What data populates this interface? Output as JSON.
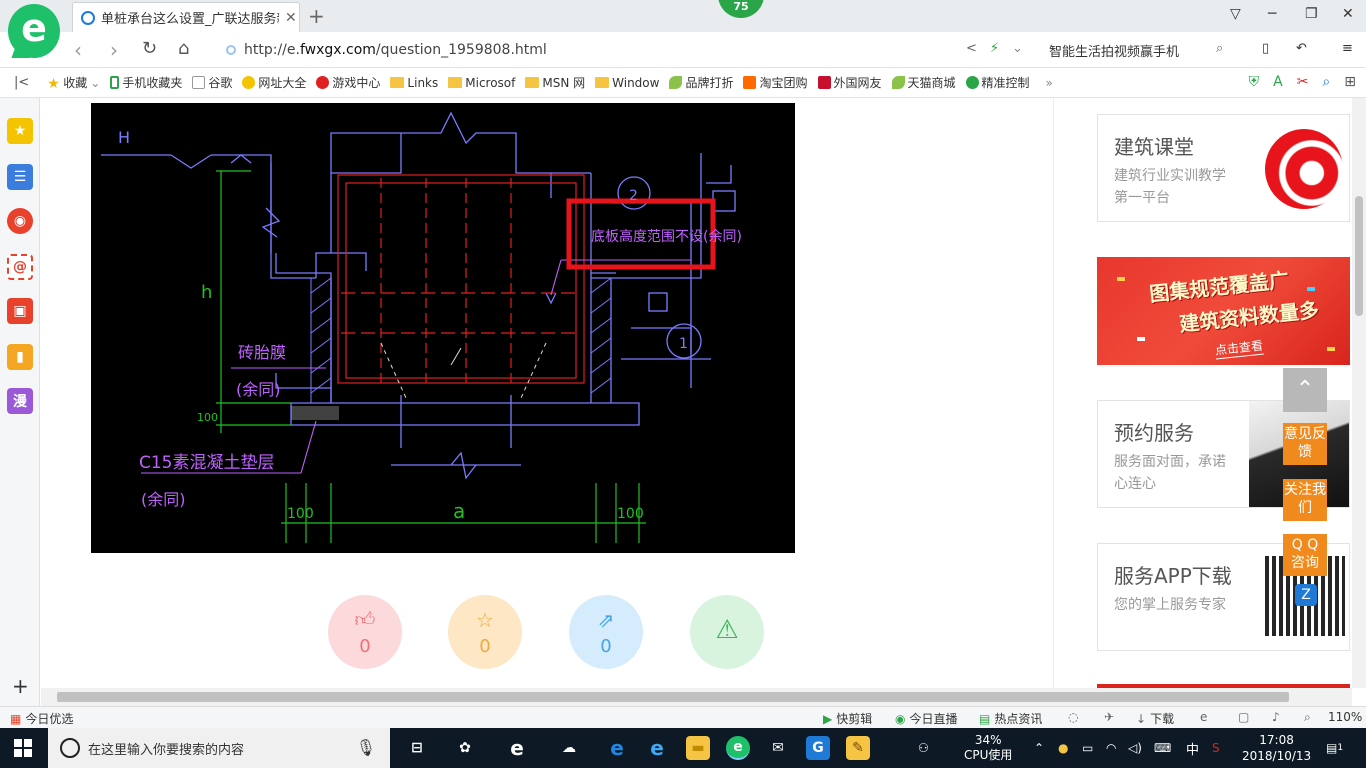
{
  "browser": {
    "badge": "75",
    "tab_title": "单桩承台这么设置_广联达服务新",
    "url_prefix": "http://e.",
    "url_host": "fwxgx.com",
    "url_path": "/question_1959808.html",
    "search_hint": "智能生活拍视频赢手机"
  },
  "bookmarks": [
    {
      "label": "收藏",
      "icon": "star-icon"
    },
    {
      "label": "手机收藏夹",
      "icon": "phone-icon"
    },
    {
      "label": "谷歌",
      "icon": "page-icon"
    },
    {
      "label": "网址大全",
      "icon": "globe-icon"
    },
    {
      "label": "游戏中心",
      "icon": "game-icon"
    },
    {
      "label": "Links",
      "icon": "folder-icon"
    },
    {
      "label": "Microsof",
      "icon": "folder-icon"
    },
    {
      "label": "MSN 网",
      "icon": "folder-icon"
    },
    {
      "label": "Window",
      "icon": "folder-icon"
    },
    {
      "label": "品牌打折",
      "icon": "leaf-icon"
    },
    {
      "label": "淘宝团购",
      "icon": "taobao-icon"
    },
    {
      "label": "外国网友",
      "icon": "flag-icon"
    },
    {
      "label": "天猫商城",
      "icon": "leaf-icon"
    },
    {
      "label": "精准控制",
      "icon": "wechat-icon"
    }
  ],
  "sidebar_manga_label": "漫",
  "cad": {
    "label_H": "H",
    "label_h": "h",
    "label_2": "2",
    "label_1": "1",
    "annotation_box": "底板高度范围不设(余同)",
    "label_brick": "砖胎膜",
    "label_same1": "(余同)",
    "label_c15": "C15素混凝土垫层",
    "label_same2": "(余同)",
    "dim_left": "100",
    "dim_mid": "a",
    "dim_right": "100",
    "dim_small": "100",
    "colors": {
      "frame": "#7b7bff",
      "red": "#e02020",
      "green": "#20c020",
      "magenta": "#c060ff",
      "highlight": "#e8141b"
    }
  },
  "actions": [
    {
      "name": "like",
      "icon": "thumbs-up-icon",
      "count": "0",
      "bg": "#fcd9db",
      "fg": "#f07078"
    },
    {
      "name": "favorite",
      "icon": "star-icon",
      "count": "0",
      "bg": "#fde7c4",
      "fg": "#f0a840"
    },
    {
      "name": "share",
      "icon": "share-icon",
      "count": "0",
      "bg": "#d4ecfb",
      "fg": "#46a3e6"
    },
    {
      "name": "report",
      "icon": "warning-icon",
      "count": "",
      "bg": "#d8f4df",
      "fg": "#3cb45a"
    }
  ],
  "right": {
    "card1_title": "建筑课堂",
    "card1_sub": "建筑行业实训教学第一平台",
    "promo_line1": "图集规范覆盖广",
    "promo_line2": "建筑资料数量多",
    "promo_button": "点击查看",
    "card2_title": "预约服务",
    "card2_sub": "服务面对面，承诺心连心",
    "card3_title": "服务APP下载",
    "card3_sub": "您的掌上服务专家",
    "float_feedback": "意见反馈",
    "float_follow": "关注我们",
    "float_qq": "Q Q 咨询"
  },
  "status": {
    "left": "今日优选",
    "kuaijian": "快剪辑",
    "live": "今日直播",
    "news": "热点资讯",
    "download": "下载",
    "zoom": "110%"
  },
  "taskbar": {
    "search_placeholder": "在这里输入你要搜索的内容",
    "cpu_percent": "34%",
    "cpu_label": "CPU使用",
    "ime": "中",
    "time": "17:08",
    "date": "2018/10/13",
    "notif_count": "1"
  }
}
